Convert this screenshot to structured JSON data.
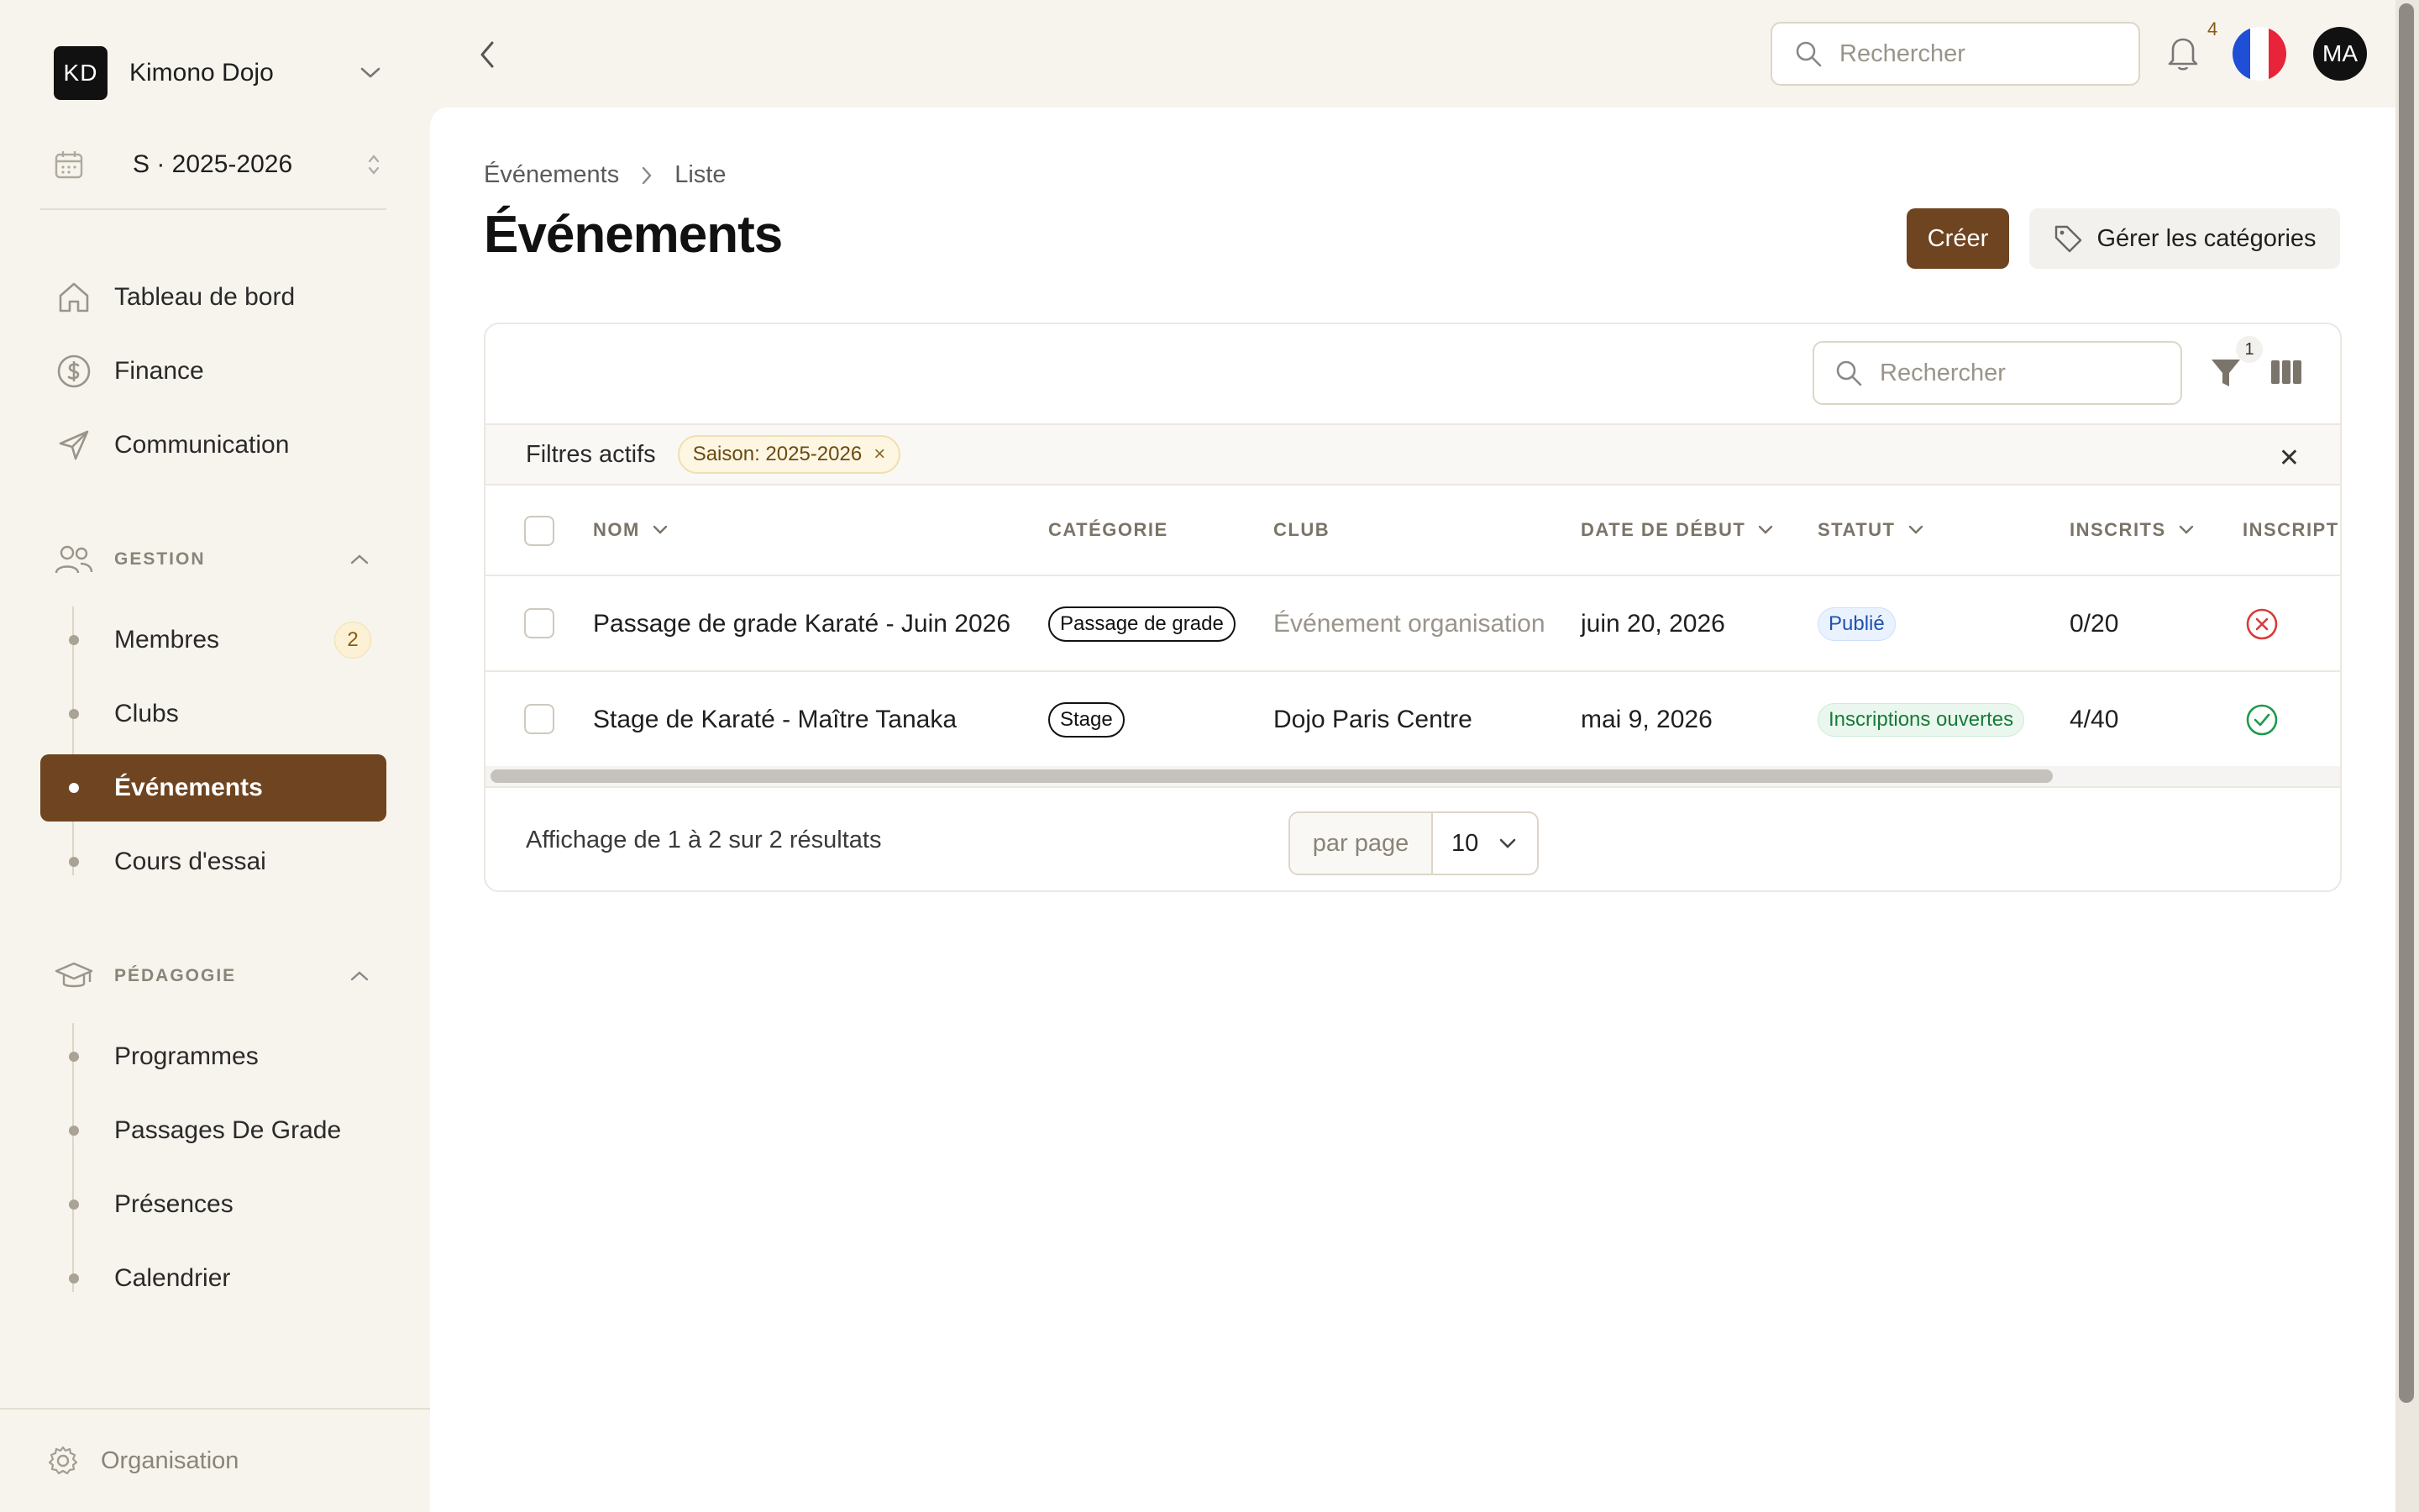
{
  "sidebar": {
    "org": {
      "initials": "KD",
      "name": "Kimono Dojo"
    },
    "season": "S · 2025-2026",
    "nav": [
      {
        "label": "Tableau de bord",
        "icon": "home-icon"
      },
      {
        "label": "Finance",
        "icon": "dollar-circle-icon"
      },
      {
        "label": "Communication",
        "icon": "send-icon"
      }
    ],
    "gestion": {
      "title": "GESTION",
      "items": [
        {
          "label": "Membres",
          "badge": "2"
        },
        {
          "label": "Clubs"
        },
        {
          "label": "Événements"
        },
        {
          "label": "Cours d'essai"
        }
      ]
    },
    "pedagogie": {
      "title": "PÉDAGOGIE",
      "items": [
        {
          "label": "Programmes"
        },
        {
          "label": "Passages De Grade"
        },
        {
          "label": "Présences"
        },
        {
          "label": "Calendrier"
        }
      ]
    },
    "organisation": "Organisation"
  },
  "topbar": {
    "search_placeholder": "Rechercher",
    "notifications_count": "4",
    "avatar_initials": "MA",
    "language_flag": "fr"
  },
  "page": {
    "breadcrumb": [
      "Événements",
      "Liste"
    ],
    "title": "Événements",
    "create_label": "Créer",
    "manage_categories_label": "Gérer les catégories"
  },
  "table": {
    "search_placeholder": "Rechercher",
    "filter_count": "1",
    "active_filters_label": "Filtres actifs",
    "active_filter_chip": "Saison: 2025-2026",
    "columns": [
      "NOM",
      "CATÉGORIE",
      "CLUB",
      "DATE DE DÉBUT",
      "STATUT",
      "INSCRITS",
      "INSCRIPTI"
    ],
    "rows": [
      {
        "name": "Passage de grade Karaté - Juin 2026",
        "category": "Passage de grade",
        "club": "Événement organisation",
        "start_date": "juin 20, 2026",
        "status": "Publié",
        "registered": "0/20",
        "registration_open": false
      },
      {
        "name": "Stage de Karaté - Maître Tanaka",
        "category": "Stage",
        "club": "Dojo Paris Centre",
        "start_date": "mai 9, 2026",
        "status": "Inscriptions ouvertes",
        "registered": "4/40",
        "registration_open": true
      }
    ],
    "summary": "Affichage de 1 à 2 sur 2 résultats",
    "per_page_label": "par page",
    "per_page_value": "10"
  },
  "colors": {
    "accent": "#6f4420",
    "background": "#f7f4ee",
    "status_red": "#d93a3a",
    "status_green": "#1f9a4a"
  }
}
